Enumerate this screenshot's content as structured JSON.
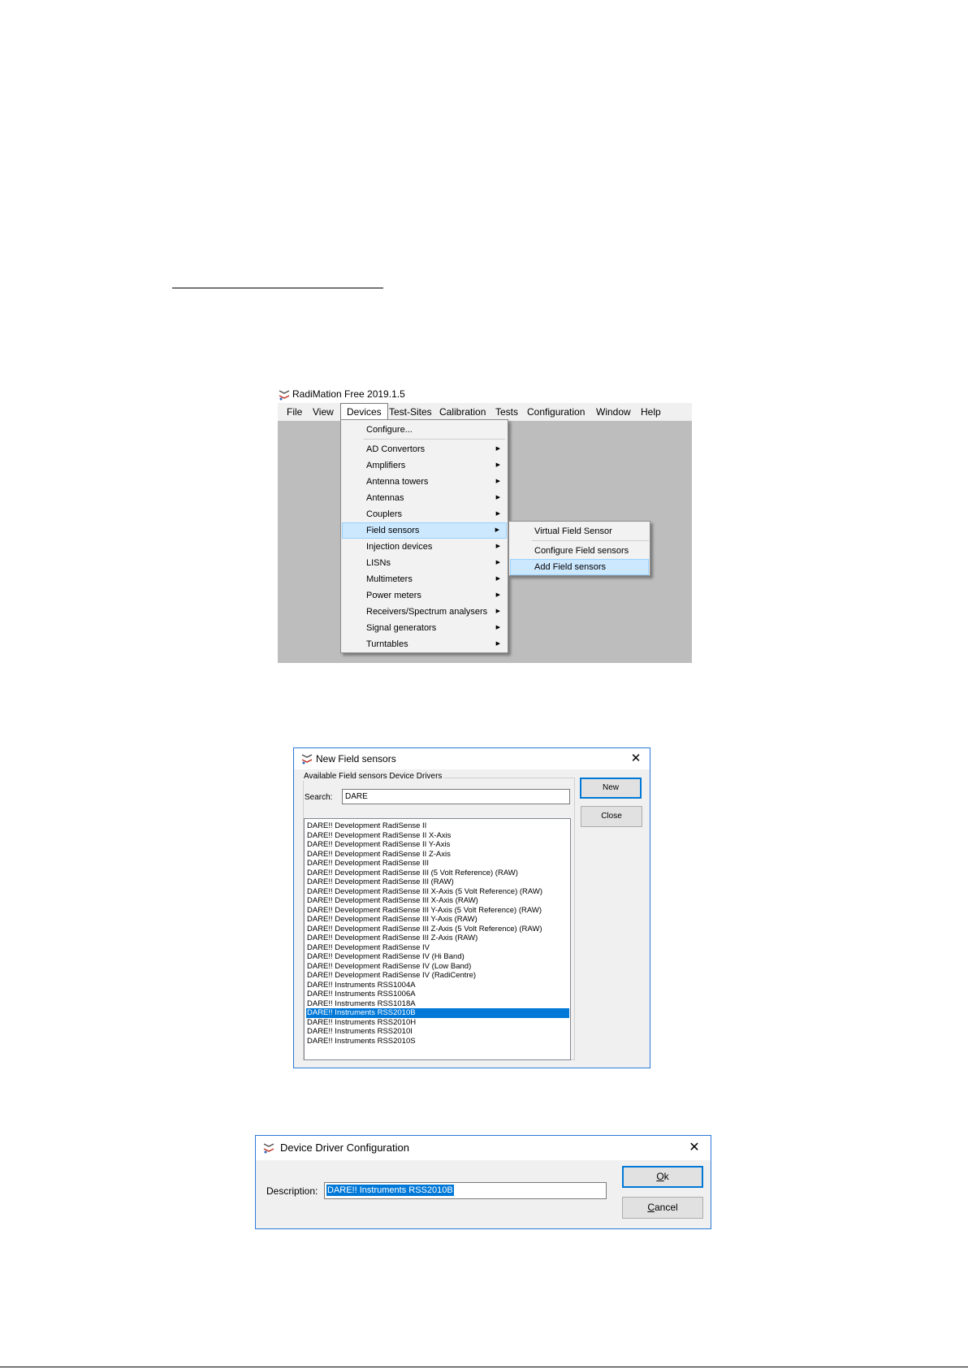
{
  "menu_screenshot": {
    "app_title": "RadiMation Free 2019.1.5",
    "menubar": [
      "File",
      "View",
      "Devices",
      "Test-Sites",
      "Calibration",
      "Tests",
      "Configuration",
      "Window",
      "Help"
    ],
    "active_menu": "Devices",
    "devices_menu": {
      "configure": "Configure...",
      "items": [
        "AD Convertors",
        "Amplifiers",
        "Antenna towers",
        "Antennas",
        "Couplers",
        "Field sensors",
        "Injection devices",
        "LISNs",
        "Multimeters",
        "Power meters",
        "Receivers/Spectrum analysers",
        "Signal generators",
        "Turntables"
      ],
      "highlighted": "Field sensors"
    },
    "field_sensors_submenu": {
      "items": [
        "Virtual Field Sensor",
        "Configure Field sensors",
        "Add Field sensors"
      ],
      "highlighted": "Add Field sensors"
    }
  },
  "new_field_sensors_dialog": {
    "title": "New Field sensors",
    "group_label": "Available Field sensors Device Drivers",
    "search_label": "Search:",
    "search_value": "DARE",
    "list_items": [
      "DARE!! Development RadiSense II",
      "DARE!! Development RadiSense II X-Axis",
      "DARE!! Development RadiSense II Y-Axis",
      "DARE!! Development RadiSense II Z-Axis",
      "DARE!! Development RadiSense III",
      "DARE!! Development RadiSense III (5 Volt Reference) (RAW)",
      "DARE!! Development RadiSense III (RAW)",
      "DARE!! Development RadiSense III X-Axis (5 Volt Reference) (RAW)",
      "DARE!! Development RadiSense III X-Axis (RAW)",
      "DARE!! Development RadiSense III Y-Axis (5 Volt Reference) (RAW)",
      "DARE!! Development RadiSense III Y-Axis (RAW)",
      "DARE!! Development RadiSense III Z-Axis (5 Volt Reference) (RAW)",
      "DARE!! Development RadiSense III Z-Axis (RAW)",
      "DARE!! Development RadiSense IV",
      "DARE!! Development RadiSense IV (Hi Band)",
      "DARE!! Development RadiSense IV (Low Band)",
      "DARE!! Development RadiSense IV (RadiCentre)",
      "DARE!! Instruments RSS1004A",
      "DARE!! Instruments RSS1006A",
      "DARE!! Instruments RSS1018A",
      "DARE!! Instruments RSS2010B",
      "DARE!! Instruments RSS2010H",
      "DARE!! Instruments RSS2010I",
      "DARE!! Instruments RSS2010S"
    ],
    "selected_index": 20,
    "new_button": "New",
    "close_button": "Close"
  },
  "device_driver_dialog": {
    "title": "Device Driver Configuration",
    "description_label": "Description:",
    "description_value": "DARE!! Instruments RSS2010B",
    "ok_button": "Ok",
    "cancel_button": "Cancel"
  }
}
